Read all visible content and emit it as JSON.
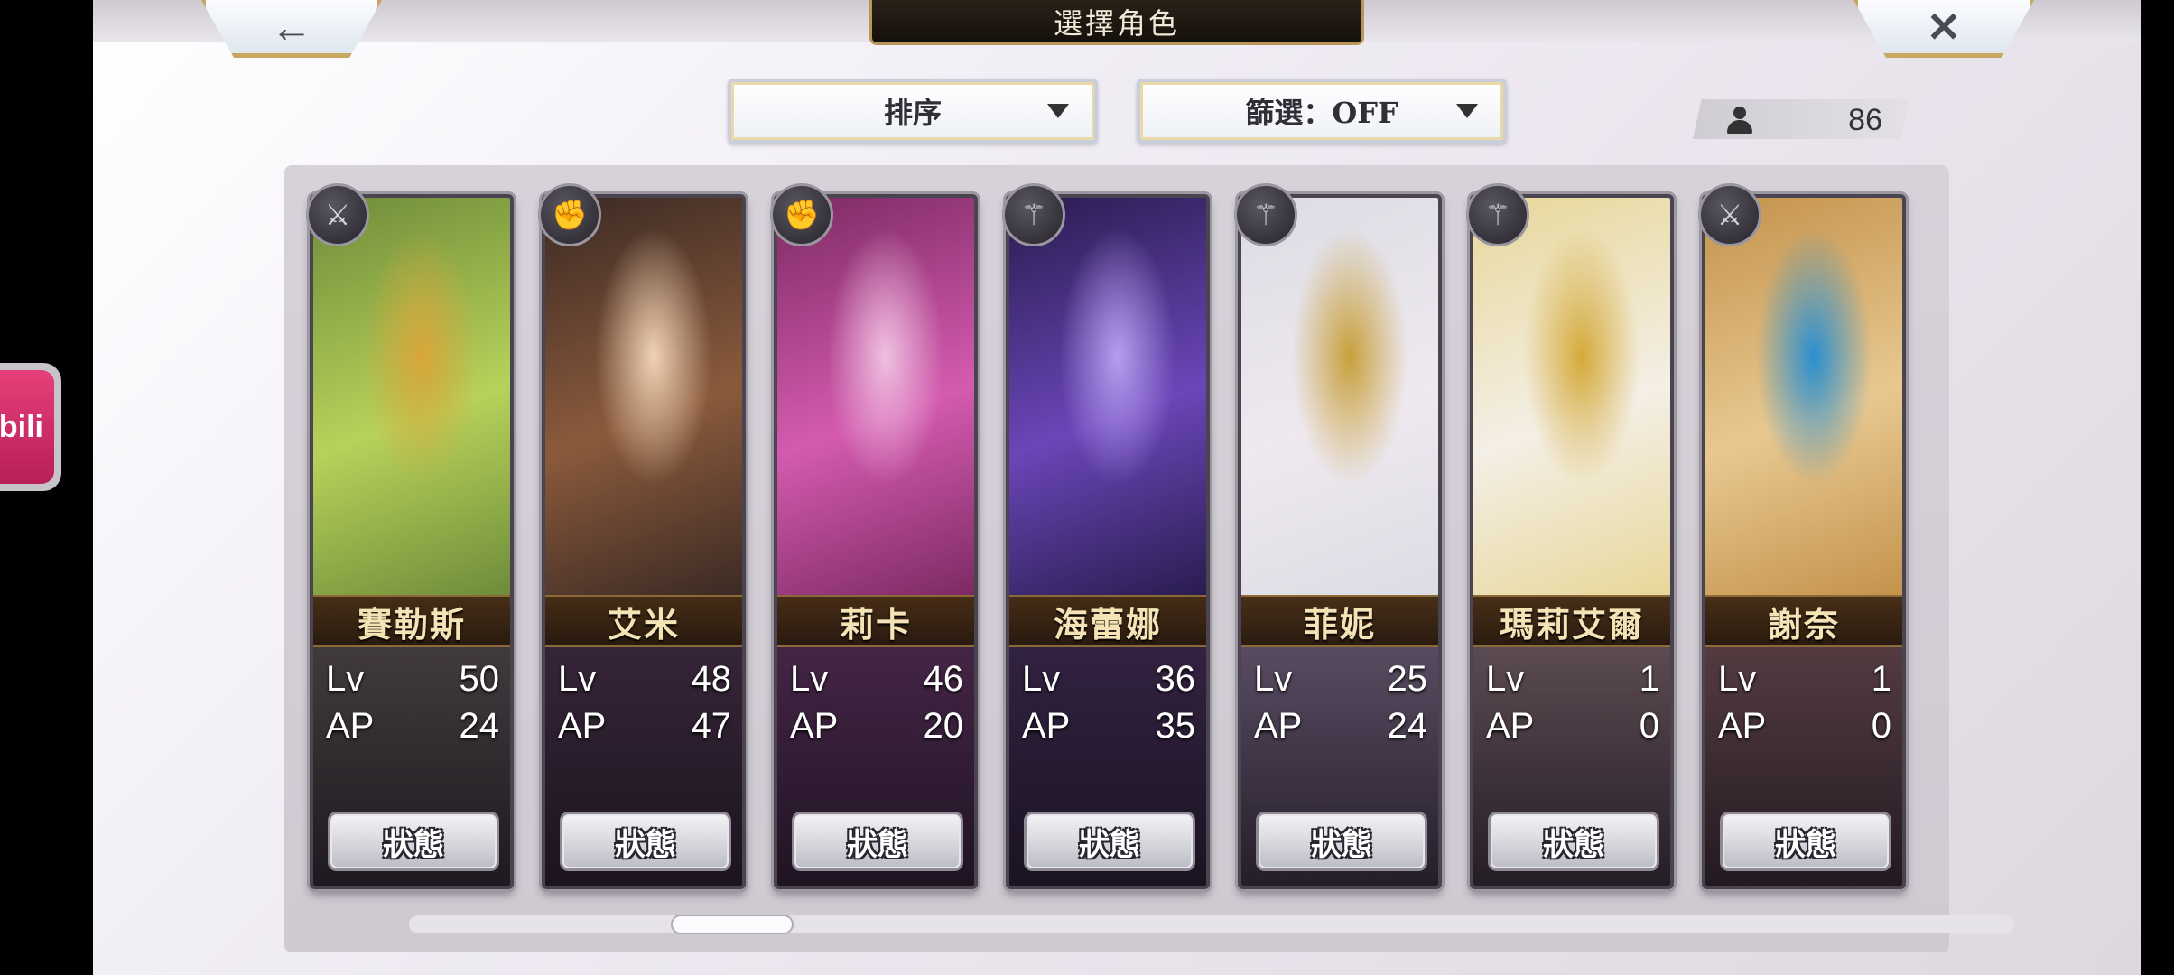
{
  "header": {
    "title": "選擇角色",
    "back_icon": "←",
    "close_icon": "✕"
  },
  "controls": {
    "sort_label": "排序",
    "filter_label": "篩選：OFF",
    "character_count": "86"
  },
  "overlay": {
    "bilibili_label": "bili"
  },
  "characters": [
    {
      "name": "賽勒斯",
      "lv_label": "Lv",
      "lv": "50",
      "ap_label": "AP",
      "ap": "24",
      "status_label": "狀態",
      "class_icon": "sword-icon",
      "colors": {
        "top": "#6e8c3a",
        "mid": "#b7d25a",
        "accent": "#d8a63a"
      }
    },
    {
      "name": "艾米",
      "lv_label": "Lv",
      "lv": "48",
      "ap_label": "AP",
      "ap": "47",
      "status_label": "狀態",
      "class_icon": "fist-icon",
      "colors": {
        "top": "#3b2a24",
        "mid": "#8b5a3c",
        "accent": "#f0d2b4"
      }
    },
    {
      "name": "莉卡",
      "lv_label": "Lv",
      "lv": "46",
      "ap_label": "AP",
      "ap": "20",
      "status_label": "狀態",
      "class_icon": "fist-icon",
      "colors": {
        "top": "#7d2a63",
        "mid": "#d45bb0",
        "accent": "#f0c0e0"
      }
    },
    {
      "name": "海蕾娜",
      "lv_label": "Lv",
      "lv": "36",
      "ap_label": "AP",
      "ap": "35",
      "status_label": "狀態",
      "class_icon": "staff-icon",
      "colors": {
        "top": "#2a1c4f",
        "mid": "#6a46b8",
        "accent": "#b79df0"
      }
    },
    {
      "name": "菲妮",
      "lv_label": "Lv",
      "lv": "25",
      "ap_label": "AP",
      "ap": "24",
      "status_label": "狀態",
      "class_icon": "staff-icon",
      "colors": {
        "top": "#dcdce4",
        "mid": "#efe9ef",
        "accent": "#c8a03c"
      }
    },
    {
      "name": "瑪莉艾爾",
      "lv_label": "Lv",
      "lv": "1",
      "ap_label": "AP",
      "ap": "0",
      "status_label": "狀態",
      "class_icon": "staff-icon",
      "colors": {
        "top": "#e8d79a",
        "mid": "#f4efe6",
        "accent": "#d4aa3a"
      }
    },
    {
      "name": "謝奈",
      "lv_label": "Lv",
      "lv": "1",
      "ap_label": "AP",
      "ap": "0",
      "status_label": "狀態",
      "class_icon": "sword-icon",
      "colors": {
        "top": "#c4934c",
        "mid": "#e8c890",
        "accent": "#2a8fd0"
      }
    }
  ],
  "colors": {
    "name_text": "#f3e3b5",
    "frame_gold": "#b8965a"
  }
}
